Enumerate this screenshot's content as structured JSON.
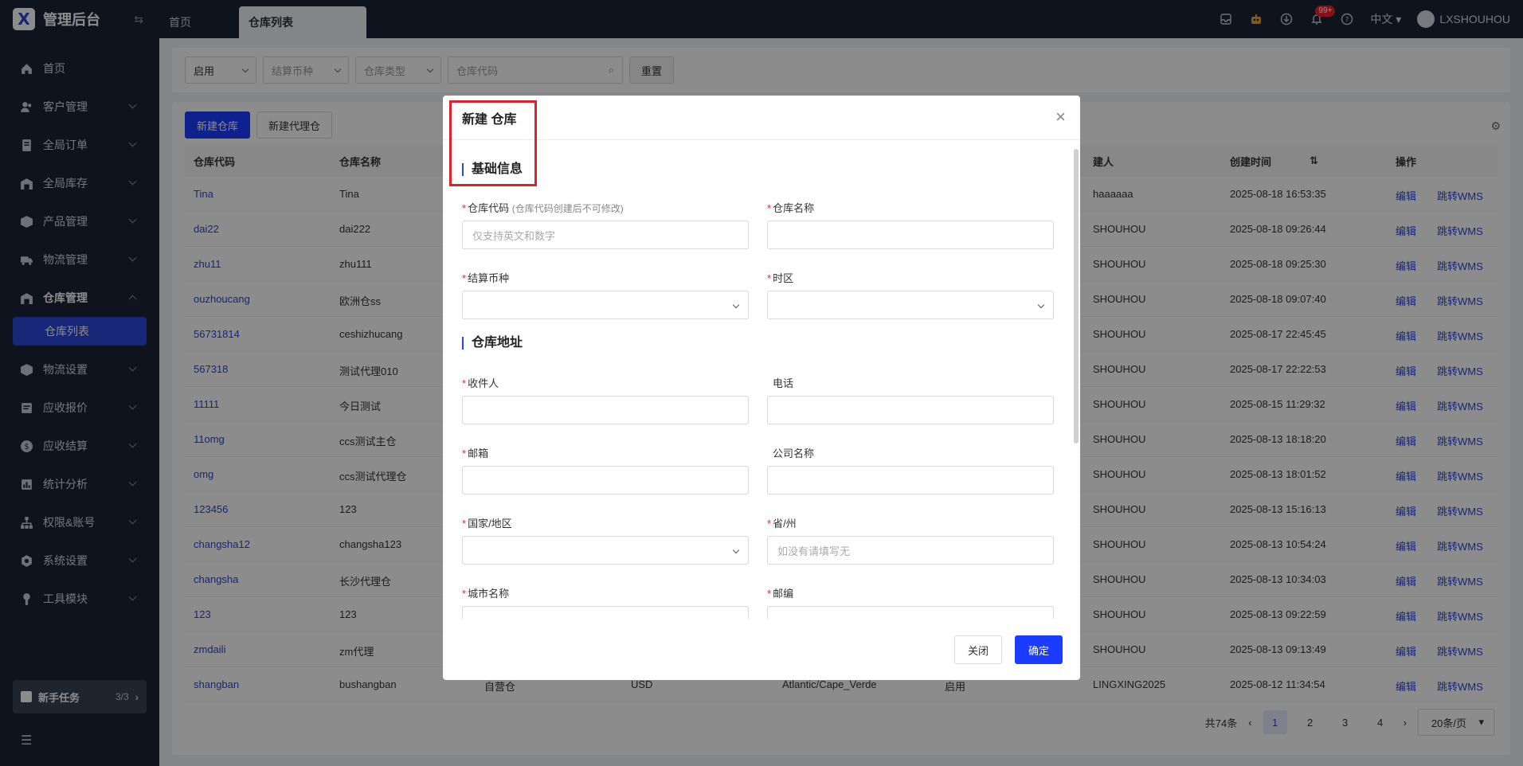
{
  "app": {
    "title": "管理后台"
  },
  "sidebar": {
    "items": [
      {
        "label": "首页",
        "icon": "home-icon",
        "expandable": false
      },
      {
        "label": "客户管理",
        "icon": "users-icon",
        "expandable": true
      },
      {
        "label": "全局订单",
        "icon": "order-icon",
        "expandable": true
      },
      {
        "label": "全局库存",
        "icon": "warehouse-icon",
        "expandable": true
      },
      {
        "label": "产品管理",
        "icon": "box-icon",
        "expandable": true
      },
      {
        "label": "物流管理",
        "icon": "truck-icon",
        "expandable": true
      },
      {
        "label": "仓库管理",
        "icon": "warehouse-icon",
        "expandable": true,
        "expanded": true
      },
      {
        "label": "物流设置",
        "icon": "box-icon",
        "expandable": true
      },
      {
        "label": "应收报价",
        "icon": "doc-icon",
        "expandable": true
      },
      {
        "label": "应收结算",
        "icon": "coin-icon",
        "expandable": true
      },
      {
        "label": "统计分析",
        "icon": "chart-icon",
        "expandable": true
      },
      {
        "label": "权限&账号",
        "icon": "org-icon",
        "expandable": true
      },
      {
        "label": "系统设置",
        "icon": "gear-icon",
        "expandable": true
      },
      {
        "label": "工具模块",
        "icon": "wrench-icon",
        "expandable": true
      }
    ],
    "active_sub": "仓库列表",
    "task": {
      "label": "新手任务",
      "count": "3/3"
    }
  },
  "topbar": {
    "tabs": [
      "首页",
      "仓库列表"
    ],
    "badge": "99+",
    "language": "中文",
    "user": "LXSHOUHOU"
  },
  "filters": {
    "status": "启用",
    "currency_placeholder": "结算币种",
    "type_placeholder": "仓库类型",
    "code_placeholder": "仓库代码",
    "reset_label": "重置"
  },
  "toolbar": {
    "new_warehouse": "新建仓库",
    "new_agent_warehouse": "新建代理仓"
  },
  "table": {
    "headers": {
      "code": "仓库代码",
      "name": "仓库名称",
      "creator": "建人",
      "created": "创建时间",
      "ops": "操作"
    },
    "edit_label": "编辑",
    "wms_label": "跳转WMS",
    "rows": [
      {
        "code": "Tina",
        "name": "Tina",
        "creator": "haaaaaa",
        "created": "2025-08-18 16:53:35"
      },
      {
        "code": "dai22",
        "name": "dai222",
        "creator": "SHOUHOU",
        "created": "2025-08-18 09:26:44"
      },
      {
        "code": "zhu11",
        "name": "zhu111",
        "creator": "SHOUHOU",
        "created": "2025-08-18 09:25:30"
      },
      {
        "code": "ouzhoucang",
        "name": "欧洲仓ss",
        "creator": "SHOUHOU",
        "created": "2025-08-18 09:07:40"
      },
      {
        "code": "56731814",
        "name": "ceshizhucang",
        "creator": "SHOUHOU",
        "created": "2025-08-17 22:45:45"
      },
      {
        "code": "567318",
        "name": "测试代理010",
        "creator": "SHOUHOU",
        "created": "2025-08-17 22:22:53"
      },
      {
        "code": "11111",
        "name": "今日测试",
        "creator": "SHOUHOU",
        "created": "2025-08-15 11:29:32"
      },
      {
        "code": "11omg",
        "name": "ccs测试主仓",
        "creator": "SHOUHOU",
        "created": "2025-08-13 18:18:20"
      },
      {
        "code": "omg",
        "name": "ccs测试代理仓",
        "creator": "SHOUHOU",
        "created": "2025-08-13 18:01:52"
      },
      {
        "code": "123456",
        "name": "123",
        "creator": "SHOUHOU",
        "created": "2025-08-13 15:16:13"
      },
      {
        "code": "changsha12",
        "name": "changsha123",
        "creator": "SHOUHOU",
        "created": "2025-08-13 10:54:24"
      },
      {
        "code": "changsha",
        "name": "长沙代理仓",
        "creator": "SHOUHOU",
        "created": "2025-08-13 10:34:03"
      },
      {
        "code": "123",
        "name": "123",
        "creator": "SHOUHOU",
        "created": "2025-08-13 09:22:59"
      },
      {
        "code": "zmdaili",
        "name": "zm代理",
        "creator": "SHOUHOU",
        "created": "2025-08-13 09:13:49"
      },
      {
        "code": "shangban",
        "name": "bushangban",
        "type": "自营仓",
        "currency": "USD",
        "timezone": "Atlantic/Cape_Verde",
        "status": "启用",
        "creator": "LINGXING2025",
        "created": "2025-08-12 11:34:54"
      }
    ]
  },
  "pager": {
    "total": "共74条",
    "pages": [
      "1",
      "2",
      "3",
      "4"
    ],
    "page_size": "20条/页"
  },
  "modal": {
    "title": "新建 仓库",
    "section_basic": "基础信息",
    "section_address": "仓库地址",
    "fields": {
      "code": {
        "label": "仓库代码",
        "hint": "(仓库代码创建后不可修改)",
        "placeholder": "仅支持英文和数字"
      },
      "name": {
        "label": "仓库名称"
      },
      "currency": {
        "label": "结算币种"
      },
      "timezone": {
        "label": "时区"
      },
      "recipient": {
        "label": "收件人"
      },
      "phone": {
        "label": "电话"
      },
      "email": {
        "label": "邮箱"
      },
      "company": {
        "label": "公司名称"
      },
      "country": {
        "label": "国家/地区"
      },
      "province": {
        "label": "省/州",
        "placeholder": "如没有请填写无"
      },
      "city": {
        "label": "城市名称"
      },
      "zip": {
        "label": "邮编"
      }
    },
    "close_label": "关闭",
    "confirm_label": "确定"
  },
  "colors": {
    "sidebar_bg": "#1c2437",
    "accent": "#2a45d8",
    "primary_button": "#1a3cff",
    "highlight_box": "#e0212d"
  }
}
